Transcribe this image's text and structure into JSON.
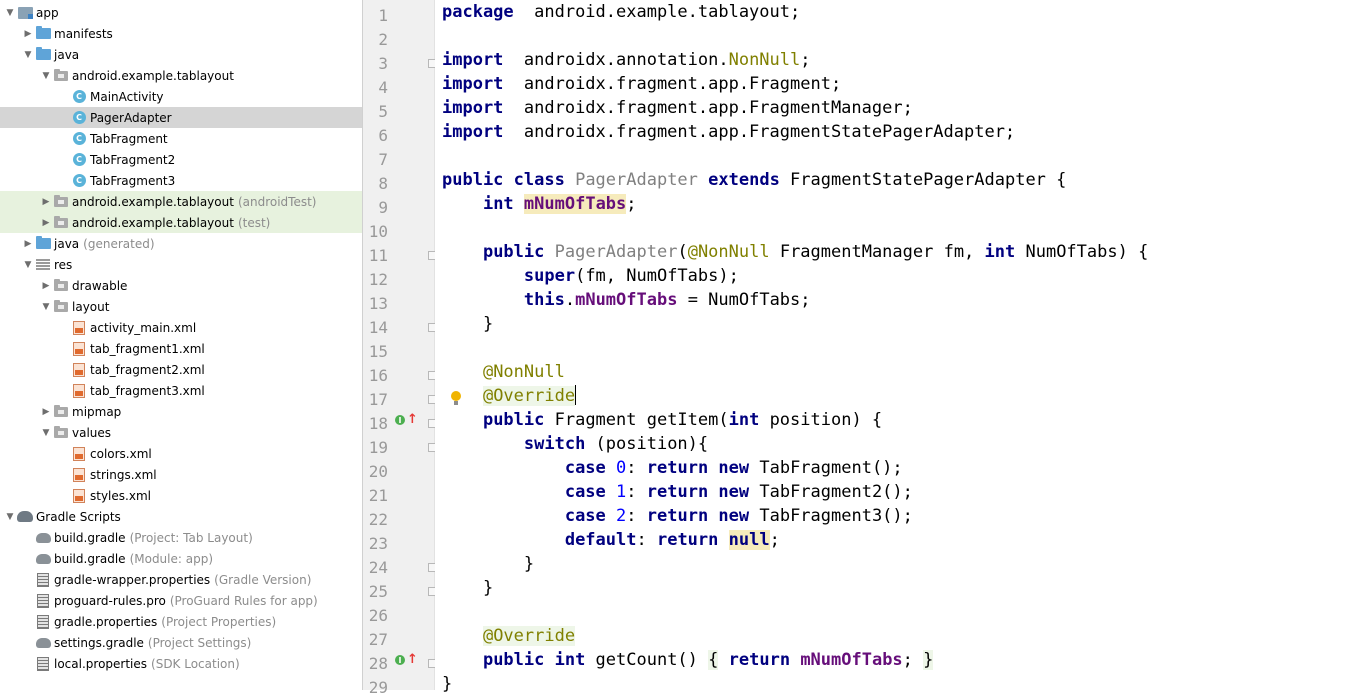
{
  "project_tree": {
    "items": [
      {
        "label": "app",
        "secondary": "",
        "icon": "app-module-icon",
        "level": 0,
        "arrow": "expanded",
        "style": ""
      },
      {
        "label": "manifests",
        "secondary": "",
        "icon": "folder-blue-icon",
        "level": 1,
        "arrow": "collapsed",
        "style": ""
      },
      {
        "label": "java",
        "secondary": "",
        "icon": "folder-blue-icon",
        "level": 1,
        "arrow": "expanded",
        "style": ""
      },
      {
        "label": "android.example.tablayout",
        "secondary": "",
        "icon": "package-icon",
        "level": 2,
        "arrow": "expanded",
        "style": ""
      },
      {
        "label": "MainActivity",
        "secondary": "",
        "icon": "java-class-icon",
        "level": 3,
        "arrow": "",
        "style": ""
      },
      {
        "label": "PagerAdapter",
        "secondary": "",
        "icon": "java-class-icon",
        "level": 3,
        "arrow": "",
        "style": "selected"
      },
      {
        "label": "TabFragment",
        "secondary": "",
        "icon": "java-class-icon",
        "level": 3,
        "arrow": "",
        "style": ""
      },
      {
        "label": "TabFragment2",
        "secondary": "",
        "icon": "java-class-icon",
        "level": 3,
        "arrow": "",
        "style": ""
      },
      {
        "label": "TabFragment3",
        "secondary": "",
        "icon": "java-class-icon",
        "level": 3,
        "arrow": "",
        "style": ""
      },
      {
        "label": "android.example.tablayout",
        "secondary": "(androidTest)",
        "icon": "package-icon",
        "level": 2,
        "arrow": "collapsed",
        "style": "green"
      },
      {
        "label": "android.example.tablayout",
        "secondary": "(test)",
        "icon": "package-icon",
        "level": 2,
        "arrow": "collapsed",
        "style": "green"
      },
      {
        "label": "java",
        "secondary": "(generated)",
        "icon": "folder-blue-icon",
        "level": 1,
        "arrow": "collapsed",
        "style": ""
      },
      {
        "label": "res",
        "secondary": "",
        "icon": "res-folder-icon",
        "level": 1,
        "arrow": "expanded",
        "style": ""
      },
      {
        "label": "drawable",
        "secondary": "",
        "icon": "package-icon",
        "level": 2,
        "arrow": "collapsed",
        "style": ""
      },
      {
        "label": "layout",
        "secondary": "",
        "icon": "package-icon",
        "level": 2,
        "arrow": "expanded",
        "style": ""
      },
      {
        "label": "activity_main.xml",
        "secondary": "",
        "icon": "xml-file-icon",
        "level": 3,
        "arrow": "",
        "style": ""
      },
      {
        "label": "tab_fragment1.xml",
        "secondary": "",
        "icon": "xml-file-icon",
        "level": 3,
        "arrow": "",
        "style": ""
      },
      {
        "label": "tab_fragment2.xml",
        "secondary": "",
        "icon": "xml-file-icon",
        "level": 3,
        "arrow": "",
        "style": ""
      },
      {
        "label": "tab_fragment3.xml",
        "secondary": "",
        "icon": "xml-file-icon",
        "level": 3,
        "arrow": "",
        "style": ""
      },
      {
        "label": "mipmap",
        "secondary": "",
        "icon": "package-icon",
        "level": 2,
        "arrow": "collapsed",
        "style": ""
      },
      {
        "label": "values",
        "secondary": "",
        "icon": "package-icon",
        "level": 2,
        "arrow": "expanded",
        "style": ""
      },
      {
        "label": "colors.xml",
        "secondary": "",
        "icon": "xml-file-icon",
        "level": 3,
        "arrow": "",
        "style": ""
      },
      {
        "label": "strings.xml",
        "secondary": "",
        "icon": "xml-file-icon",
        "level": 3,
        "arrow": "",
        "style": ""
      },
      {
        "label": "styles.xml",
        "secondary": "",
        "icon": "xml-file-icon",
        "level": 3,
        "arrow": "",
        "style": ""
      },
      {
        "label": "Gradle Scripts",
        "secondary": "",
        "icon": "gradle-scripts-icon",
        "level": 0,
        "arrow": "expanded",
        "style": ""
      },
      {
        "label": "build.gradle",
        "secondary": "(Project: Tab Layout)",
        "icon": "gradle-file-icon",
        "level": 1,
        "arrow": "",
        "style": ""
      },
      {
        "label": "build.gradle",
        "secondary": "(Module: app)",
        "icon": "gradle-file-icon",
        "level": 1,
        "arrow": "",
        "style": ""
      },
      {
        "label": "gradle-wrapper.properties",
        "secondary": "(Gradle Version)",
        "icon": "properties-file-icon",
        "level": 1,
        "arrow": "",
        "style": ""
      },
      {
        "label": "proguard-rules.pro",
        "secondary": "(ProGuard Rules for app)",
        "icon": "properties-file-icon",
        "level": 1,
        "arrow": "",
        "style": ""
      },
      {
        "label": "gradle.properties",
        "secondary": "(Project Properties)",
        "icon": "properties-file-icon",
        "level": 1,
        "arrow": "",
        "style": ""
      },
      {
        "label": "settings.gradle",
        "secondary": "(Project Settings)",
        "icon": "gradle-file-icon",
        "level": 1,
        "arrow": "",
        "style": ""
      },
      {
        "label": "local.properties",
        "secondary": "(SDK Location)",
        "icon": "properties-file-icon",
        "level": 1,
        "arrow": "",
        "style": ""
      }
    ]
  },
  "editor": {
    "current_line": 17,
    "lines": [
      {
        "n": "1",
        "tokens": [
          [
            "kw",
            "package"
          ],
          [
            "",
            "  android.example.tablayout;"
          ]
        ]
      },
      {
        "n": "2",
        "tokens": []
      },
      {
        "n": "3",
        "tokens": [
          [
            "kw",
            "import"
          ],
          [
            "",
            "  androidx.annotation."
          ],
          [
            "ann",
            "NonNull"
          ],
          [
            "",
            ";"
          ]
        ]
      },
      {
        "n": "4",
        "tokens": [
          [
            "kw",
            "import"
          ],
          [
            "",
            "  androidx.fragment.app.Fragment;"
          ]
        ]
      },
      {
        "n": "5",
        "tokens": [
          [
            "kw",
            "import"
          ],
          [
            "",
            "  androidx.fragment.app.FragmentManager;"
          ]
        ]
      },
      {
        "n": "6",
        "tokens": [
          [
            "kw",
            "import"
          ],
          [
            "",
            "  androidx.fragment.app.FragmentStatePagerAdapter;"
          ]
        ]
      },
      {
        "n": "7",
        "tokens": []
      },
      {
        "n": "8",
        "tokens": [
          [
            "kw",
            "public class"
          ],
          [
            "",
            " "
          ],
          [
            "dim",
            "PagerAdapter"
          ],
          [
            "",
            " "
          ],
          [
            "kw",
            "extends"
          ],
          [
            "",
            "",
            " FragmentStatePagerAdapter {"
          ]
        ]
      },
      {
        "n": "9",
        "tokens": [
          [
            "",
            "    "
          ],
          [
            "kw",
            "int"
          ],
          [
            "",
            " "
          ],
          [
            "fld hl-fld",
            "mNumOfTabs"
          ],
          [
            "",
            ";"
          ]
        ]
      },
      {
        "n": "10",
        "tokens": []
      },
      {
        "n": "11",
        "tokens": [
          [
            "",
            "    "
          ],
          [
            "kw",
            "public"
          ],
          [
            "",
            " "
          ],
          [
            "dim",
            "PagerAdapter"
          ],
          [
            "",
            "("
          ],
          [
            "ann",
            "@NonNull"
          ],
          [
            "",
            " FragmentManager fm, "
          ],
          [
            "kw",
            "int"
          ],
          [
            "",
            " NumOfTabs) {"
          ]
        ]
      },
      {
        "n": "12",
        "tokens": [
          [
            "",
            "        "
          ],
          [
            "kw",
            "super"
          ],
          [
            "",
            "(fm, NumOfTabs);"
          ]
        ]
      },
      {
        "n": "13",
        "tokens": [
          [
            "",
            "        "
          ],
          [
            "kw",
            "this"
          ],
          [
            "",
            "."
          ],
          [
            "fld",
            "mNumOfTabs"
          ],
          [
            "",
            " = NumOfTabs;"
          ]
        ]
      },
      {
        "n": "14",
        "tokens": [
          [
            "",
            "    }"
          ]
        ]
      },
      {
        "n": "15",
        "tokens": []
      },
      {
        "n": "16",
        "tokens": [
          [
            "",
            "    "
          ],
          [
            "ann",
            "@NonNull"
          ]
        ]
      },
      {
        "n": "17",
        "tokens": [
          [
            "",
            "    "
          ],
          [
            "ann hl-override",
            "@Override"
          ]
        ]
      },
      {
        "n": "18",
        "tokens": [
          [
            "",
            "    "
          ],
          [
            "kw",
            "public"
          ],
          [
            "",
            " Fragment getItem("
          ],
          [
            "kw",
            "int"
          ],
          [
            "",
            " position) {"
          ]
        ]
      },
      {
        "n": "19",
        "tokens": [
          [
            "",
            "        "
          ],
          [
            "kw",
            "switch"
          ],
          [
            "",
            " (position){"
          ]
        ]
      },
      {
        "n": "20",
        "tokens": [
          [
            "",
            "            "
          ],
          [
            "kw",
            "case"
          ],
          [
            "",
            " "
          ],
          [
            "num",
            "0"
          ],
          [
            "",
            ": "
          ],
          [
            "kw",
            "return new"
          ],
          [
            "",
            " TabFragment();"
          ]
        ]
      },
      {
        "n": "21",
        "tokens": [
          [
            "",
            "            "
          ],
          [
            "kw",
            "case"
          ],
          [
            "",
            " "
          ],
          [
            "num",
            "1"
          ],
          [
            "",
            ": "
          ],
          [
            "kw",
            "return new"
          ],
          [
            "",
            " TabFragment2();"
          ]
        ]
      },
      {
        "n": "22",
        "tokens": [
          [
            "",
            "            "
          ],
          [
            "kw",
            "case"
          ],
          [
            "",
            " "
          ],
          [
            "num",
            "2"
          ],
          [
            "",
            ": "
          ],
          [
            "kw",
            "return new"
          ],
          [
            "",
            " TabFragment3();"
          ]
        ]
      },
      {
        "n": "23",
        "tokens": [
          [
            "",
            "            "
          ],
          [
            "kw",
            "default"
          ],
          [
            "",
            ": "
          ],
          [
            "kw",
            "return"
          ],
          [
            "",
            " "
          ],
          [
            "kw hl-null",
            "null"
          ],
          [
            "",
            ";"
          ]
        ]
      },
      {
        "n": "24",
        "tokens": [
          [
            "",
            "        }"
          ]
        ]
      },
      {
        "n": "25",
        "tokens": [
          [
            "",
            "    }"
          ]
        ]
      },
      {
        "n": "26",
        "tokens": []
      },
      {
        "n": "27",
        "tokens": [
          [
            "",
            "    "
          ],
          [
            "ann hl-override",
            "@Override"
          ]
        ]
      },
      {
        "n": "28",
        "tokens": [
          [
            "",
            "    "
          ],
          [
            "kw",
            "public int"
          ],
          [
            "",
            " getCount() "
          ],
          [
            "hl-override",
            "{"
          ],
          [
            "",
            " "
          ],
          [
            "kw",
            "return"
          ],
          [
            "",
            " "
          ],
          [
            "fld",
            "mNumOfTabs"
          ],
          [
            "",
            "; "
          ],
          [
            "hl-override",
            "}"
          ]
        ]
      },
      {
        "n": "29",
        "tokens": [
          [
            "",
            "}"
          ]
        ]
      }
    ],
    "fold_lines": [
      3,
      11,
      14,
      16,
      17,
      18,
      19,
      24,
      25,
      28
    ],
    "override_marker_lines": [
      18,
      28
    ],
    "intention_bulb_line": 17
  },
  "colors": {
    "keyword": "#00007f",
    "annotation": "#808000",
    "field": "#660e7a",
    "selection_tree": "#d5d5d5",
    "test_source_tree": "#e7f2de",
    "current_line": "#fdf8e2"
  }
}
